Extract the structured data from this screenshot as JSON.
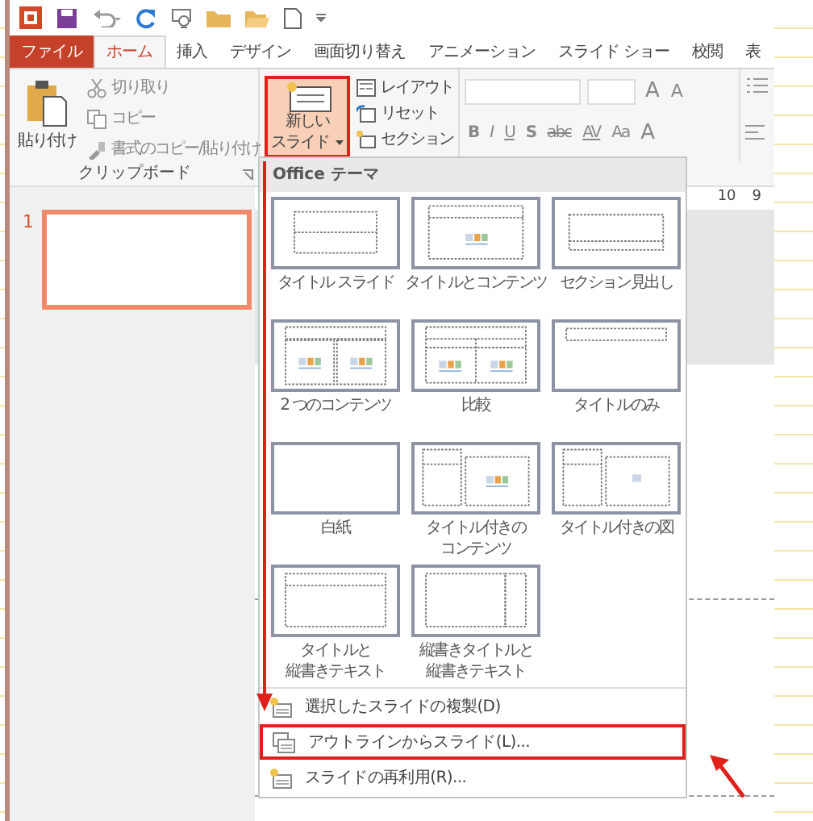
{
  "tabs": [
    {
      "label": "ファイル",
      "kind": "file",
      "selected": false
    },
    {
      "label": "ホーム",
      "kind": "tab",
      "selected": true
    },
    {
      "label": "挿入",
      "kind": "tab",
      "selected": false
    },
    {
      "label": "デザイン",
      "kind": "tab",
      "selected": false
    },
    {
      "label": "画面切り替え",
      "kind": "tab",
      "selected": false
    },
    {
      "label": "アニメーション",
      "kind": "tab",
      "selected": false
    },
    {
      "label": "スライド ショー",
      "kind": "tab",
      "selected": false
    },
    {
      "label": "校閲",
      "kind": "tab",
      "selected": false
    },
    {
      "label": "表",
      "kind": "tab",
      "selected": false
    }
  ],
  "clipboard": {
    "paste": "貼り付け",
    "cut": "切り取り",
    "copy": "コピー",
    "format_painter": "書式のコピー/貼り付け",
    "group_label": "クリップボード"
  },
  "slides_group": {
    "new_slide": {
      "lines": [
        "新しい",
        "スライド"
      ],
      "highlighted": true
    },
    "layout": "レイアウト",
    "reset": "リセット",
    "section": "セクション"
  },
  "font_group": {
    "row_1": [
      "A",
      "A"
    ],
    "row_2": [
      "B",
      "I",
      "U",
      "S",
      "abc",
      "AV",
      "Aa",
      "A"
    ]
  },
  "slide_panel": {
    "thumbnails": [
      {
        "number": "1",
        "selected": true
      }
    ]
  },
  "ruler": [
    "10",
    "9"
  ],
  "new_slide_menu": {
    "header": "Office テーマ",
    "layouts": [
      {
        "lines": [
          "タイトル スライド"
        ],
        "kind": "title"
      },
      {
        "lines": [
          "タイトルとコンテンツ"
        ],
        "kind": "title-content"
      },
      {
        "lines": [
          "セクション見出し"
        ],
        "kind": "section"
      },
      {
        "lines": [
          "2 つのコンテンツ"
        ],
        "kind": "two-content"
      },
      {
        "lines": [
          "比較"
        ],
        "kind": "comparison"
      },
      {
        "lines": [
          "タイトルのみ"
        ],
        "kind": "title-only"
      },
      {
        "lines": [
          "白紙"
        ],
        "kind": "blank"
      },
      {
        "lines": [
          "タイトル付きの",
          "コンテンツ"
        ],
        "kind": "content-caption"
      },
      {
        "lines": [
          "タイトル付きの図"
        ],
        "kind": "picture-caption"
      },
      {
        "lines": [
          "タイトルと",
          "縦書きテキスト"
        ],
        "kind": "vertical-text"
      },
      {
        "lines": [
          "縦書きタイトルと",
          "縦書きテキスト"
        ],
        "kind": "vertical-title"
      }
    ],
    "commands": [
      {
        "label": "選択したスライドの複製(D)",
        "highlighted": false
      },
      {
        "label": "アウトラインからスライド(L)...",
        "highlighted": true
      },
      {
        "label": "スライドの再利用(R)...",
        "highlighted": false
      }
    ]
  }
}
